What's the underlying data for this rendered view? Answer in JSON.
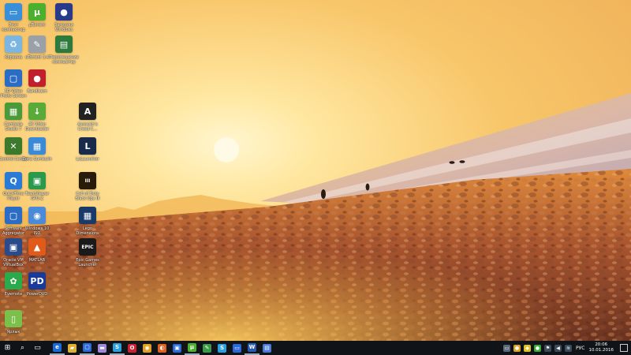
{
  "desktop": {
    "icons": [
      {
        "label": "Этот компьютер",
        "icon": "computer-icon",
        "color": "#3a8fd8",
        "glyph": "▭"
      },
      {
        "label": "µTorrent",
        "icon": "utorrent-icon",
        "color": "#4caf2e",
        "glyph": "µ"
      },
      {
        "label": "Загрузки Windows",
        "icon": "globe-icon",
        "color": "#2a3a8a",
        "glyph": "●"
      },
      {
        "label": "Корзина",
        "icon": "recycle-bin-icon",
        "color": "#7bb6e0",
        "glyph": "♻"
      },
      {
        "label": "uTorrent 3.4",
        "icon": "tool-icon",
        "color": "#9aa0a8",
        "glyph": "✎"
      },
      {
        "label": "Перемещение компьютер",
        "icon": "monitor-icon",
        "color": "#2c7a3c",
        "glyph": "▤"
      },
      {
        "label": "3D Video Photo Screen",
        "icon": "window-icon",
        "color": "#2b6cc4",
        "glyph": "▢"
      },
      {
        "label": "Bandicam",
        "icon": "bandicam-icon",
        "color": "#c0202a",
        "glyph": "●"
      },
      {
        "label": "Camtasia Studio 7",
        "icon": "camtasia-icon",
        "color": "#4a9a3a",
        "glyph": "▦"
      },
      {
        "label": "4K Video Downloader",
        "icon": "download-icon",
        "color": "#5aaa3a",
        "glyph": "↓"
      },
      {
        "label": "Assassin's Creed C...",
        "icon": "assassins-creed-icon",
        "color": "#222222",
        "glyph": "A"
      },
      {
        "label": "Control Center",
        "icon": "control-center-icon",
        "color": "#3a7a2a",
        "glyph": "✕"
      },
      {
        "label": "Zona Sumkulin",
        "icon": "zona-icon",
        "color": "#3a8ad8",
        "glyph": "▦"
      },
      {
        "label": "LoLauncher",
        "icon": "league-icon",
        "color": "#1a2a4a",
        "glyph": "L"
      },
      {
        "label": "QuickTime Player",
        "icon": "quicktime-icon",
        "color": "#2a7ad8",
        "glyph": "Q"
      },
      {
        "label": "TeamViewer GPU-Z",
        "icon": "teamviewer-icon",
        "color": "#2a9a4a",
        "glyph": "▣"
      },
      {
        "label": "Call of Duty Black Ops III",
        "icon": "black-ops-icon",
        "color": "#2a1a0a",
        "glyph": "III"
      },
      {
        "label": "Software Aggregator",
        "icon": "app-icon",
        "color": "#2b6cc4",
        "glyph": "▢"
      },
      {
        "label": "Windows 10 ISO",
        "icon": "disc-icon",
        "color": "#4a8ad8",
        "glyph": "◉"
      },
      {
        "label": "Lego Dimensions",
        "icon": "game-icon",
        "color": "#1a3a6a",
        "glyph": "▦"
      },
      {
        "label": "Oracle VM VirtualBox",
        "icon": "virtualbox-icon",
        "color": "#2a4a8a",
        "glyph": "▣"
      },
      {
        "label": "MATLAB",
        "icon": "matlab-icon",
        "color": "#e05a1a",
        "glyph": "▲"
      },
      {
        "label": "Epic Games Launcher",
        "icon": "epic-games-icon",
        "color": "#1a1a1a",
        "glyph": "EPIC"
      },
      {
        "label": "Evernote",
        "icon": "evernote-icon",
        "color": "#2aaa4a",
        "glyph": "✿"
      },
      {
        "label": "PowerDVD",
        "icon": "powerdvd-icon",
        "color": "#1a3a9a",
        "glyph": "PD"
      },
      {
        "label": "Ярлык",
        "icon": "folder-icon",
        "color": "#7ac04a",
        "glyph": "▯"
      }
    ]
  },
  "taskbar": {
    "apps": [
      {
        "name": "start-button",
        "glyph": "⊞",
        "color": ""
      },
      {
        "name": "search-button",
        "glyph": "⌕",
        "color": ""
      },
      {
        "name": "task-view-button",
        "glyph": "▭",
        "color": ""
      },
      {
        "name": "edge-app",
        "glyph": "e",
        "color": "#1a6ad8"
      },
      {
        "name": "explorer-app",
        "glyph": "▰",
        "color": "#e0b030"
      },
      {
        "name": "store-app",
        "glyph": "▢",
        "color": "#2a6ad8"
      },
      {
        "name": "media-app",
        "glyph": "▬",
        "color": "#a08ad8"
      },
      {
        "name": "skype-app",
        "glyph": "S",
        "color": "#2aa0e0"
      },
      {
        "name": "opera-app",
        "glyph": "O",
        "color": "#d02030"
      },
      {
        "name": "chrome-app",
        "glyph": "◉",
        "color": "#e0a020"
      },
      {
        "name": "firefox-app",
        "glyph": "◐",
        "color": "#e06020"
      },
      {
        "name": "app-window",
        "glyph": "▣",
        "color": "#2a6ad8"
      },
      {
        "name": "utorrent-app",
        "glyph": "µ",
        "color": "#4caf2e"
      },
      {
        "name": "notepad-app",
        "glyph": "✎",
        "color": "#3a9a4a"
      },
      {
        "name": "skype-app-2",
        "glyph": "S",
        "color": "#2aa0e0"
      },
      {
        "name": "monitor-app",
        "glyph": "▭",
        "color": "#2a6ad8"
      },
      {
        "name": "word-app",
        "glyph": "W",
        "color": "#2a5ab0"
      },
      {
        "name": "settings-app",
        "glyph": "▤",
        "color": "#4a7ad8"
      }
    ],
    "tray": {
      "icons": [
        {
          "name": "tray-network-icon",
          "glyph": "▭",
          "color": "#5a6a7a"
        },
        {
          "name": "tray-battery-icon",
          "glyph": "●",
          "color": "#e0a020"
        },
        {
          "name": "tray-shield-icon",
          "glyph": "◆",
          "color": "#e0c020"
        },
        {
          "name": "tray-app-icon",
          "glyph": "●",
          "color": "#3aaa3a"
        },
        {
          "name": "tray-flag-icon",
          "glyph": "⚑",
          "color": "#3a4a5a"
        },
        {
          "name": "tray-volume-icon",
          "glyph": "◀",
          "color": "#3a4a5a"
        },
        {
          "name": "tray-wifi-icon",
          "glyph": "≋",
          "color": "#3a4a5a"
        }
      ],
      "language": "РУС",
      "time": "20:06",
      "date": "10.01.2016"
    }
  }
}
